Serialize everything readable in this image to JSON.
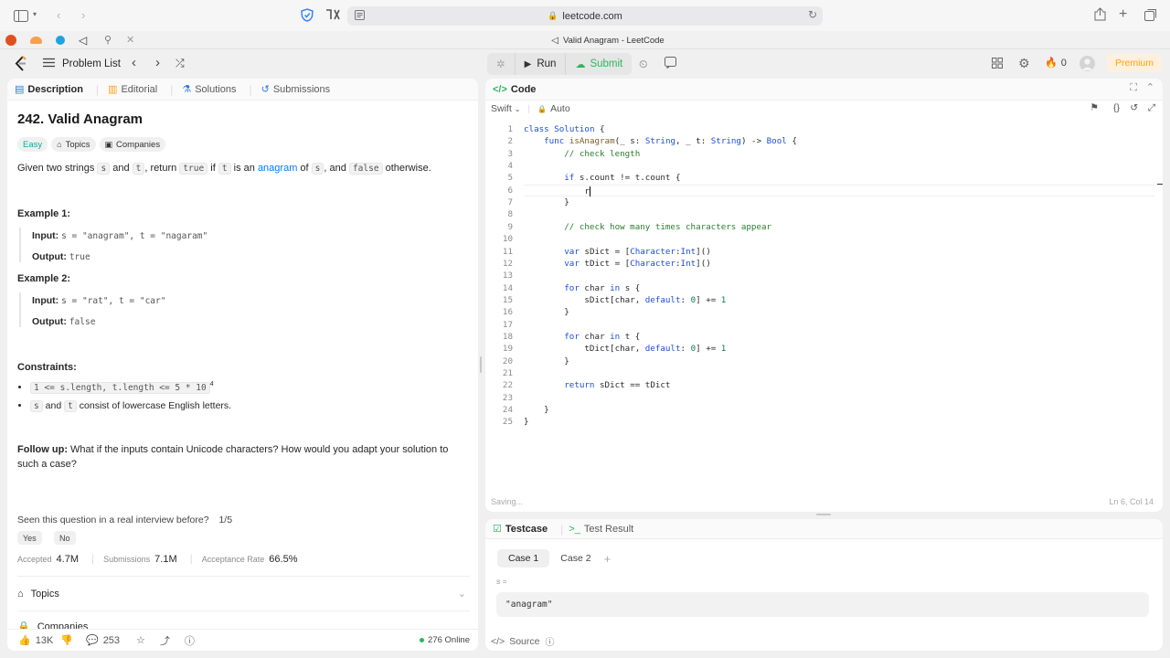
{
  "browser": {
    "url": "leetcode.com",
    "tab_title": "Valid Anagram - LeetCode"
  },
  "header": {
    "problem_list": "Problem List",
    "run": "Run",
    "submit": "Submit",
    "streak": "0",
    "premium": "Premium"
  },
  "desc_tabs": [
    {
      "label": "Description",
      "icon": "doc-icon"
    },
    {
      "label": "Editorial",
      "icon": "book-icon"
    },
    {
      "label": "Solutions",
      "icon": "flask-icon"
    },
    {
      "label": "Submissions",
      "icon": "history-icon"
    }
  ],
  "problem": {
    "title": "242. Valid Anagram",
    "difficulty": "Easy",
    "topics_tag": "Topics",
    "companies_tag": "Companies",
    "stmt": {
      "p1": "Given two strings",
      "s": "s",
      "and": "and",
      "t": "t",
      "return": ", return",
      "true": "true",
      "if": "if",
      "t2": "t",
      "is_an": "is an",
      "anagram": "anagram",
      "of": "of",
      "s2": "s",
      "and2": ", and",
      "false": "false",
      "otherwise": "otherwise."
    },
    "example1_title": "Example 1:",
    "example1_input_label": "Input:",
    "example1_input": "s = \"anagram\", t = \"nagaram\"",
    "example1_output_label": "Output:",
    "example1_output": "true",
    "example2_title": "Example 2:",
    "example2_input_label": "Input:",
    "example2_input": "s = \"rat\", t = \"car\"",
    "example2_output_label": "Output:",
    "example2_output": "false",
    "constraints_title": "Constraints:",
    "constraint1": "1 <= s.length, t.length <= 5 * 10",
    "constraint1_sup": "4",
    "constraint2_s": "s",
    "constraint2_and": "and",
    "constraint2_t": "t",
    "constraint2_rest": "consist of lowercase English letters.",
    "followup_label": "Follow up:",
    "followup_text": "What if the inputs contain Unicode characters? How would you adapt your solution to such a case?",
    "seen_question": "Seen this question in a real interview before?",
    "seen_count": "1/5",
    "yes": "Yes",
    "no": "No",
    "accepted_label": "Accepted",
    "accepted": "4.7M",
    "submissions_label": "Submissions",
    "submissions": "7.1M",
    "acceptance_label": "Acceptance Rate",
    "acceptance": "66.5%",
    "topics_section": "Topics",
    "companies_section": "Companies"
  },
  "desc_footer": {
    "likes": "13K",
    "comments": "253",
    "online": "276 Online"
  },
  "code_panel": {
    "title": "Code",
    "language": "Swift",
    "autocomplete": "Auto",
    "status": "Saving...",
    "cursor": "Ln 6, Col 14",
    "lines": [
      "class Solution {",
      "    func isAnagram(_ s: String, _ t: String) -> Bool {",
      "        // check length",
      "",
      "        if s.count != t.count {",
      "            r",
      "        }",
      "",
      "        // check how many times characters appear",
      "",
      "        var sDict = [Character:Int]()",
      "        var tDict = [Character:Int]()",
      "",
      "        for char in s {",
      "            sDict[char, default: 0] += 1",
      "        }",
      "",
      "        for char in t {",
      "            tDict[char, default: 0] += 1",
      "        }",
      "",
      "        return sDict == tDict",
      "",
      "    }",
      "}"
    ]
  },
  "test_panel": {
    "testcase_tab": "Testcase",
    "result_tab": "Test Result",
    "case1": "Case 1",
    "case2": "Case 2",
    "var_label": "s =",
    "var_value": "\"anagram\"",
    "source": "Source"
  },
  "colors": {
    "accent_green": "#2db55d",
    "easy": "#00af9b",
    "premium": "#ffa116",
    "link": "#007aff"
  }
}
